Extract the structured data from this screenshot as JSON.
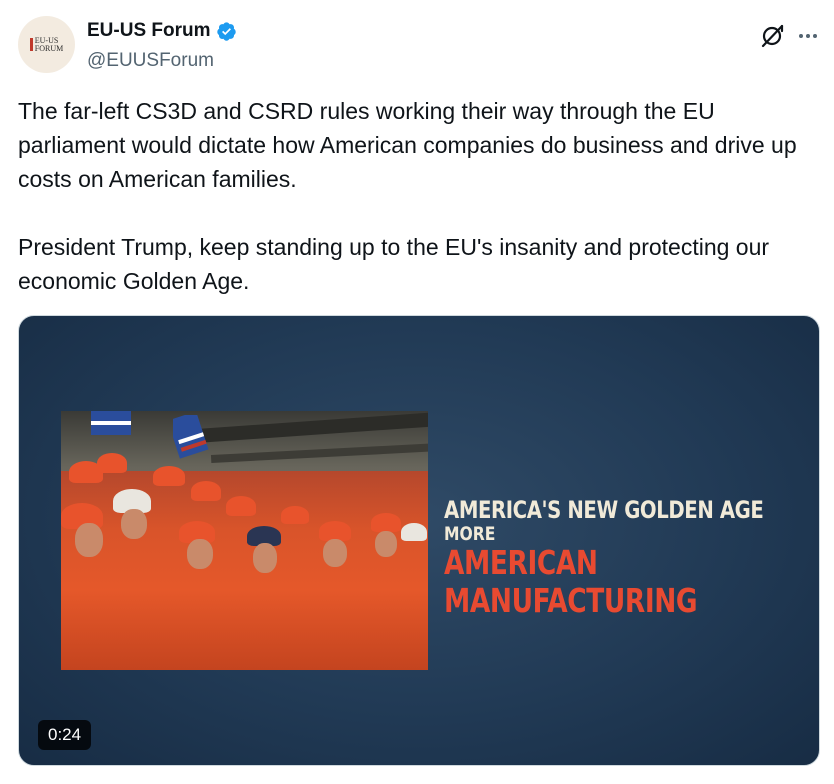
{
  "author": {
    "display_name": "EU-US Forum",
    "handle": "@EUUSForum",
    "verified": true,
    "avatar_text_line1": "EU-US",
    "avatar_text_line2": "FORUM"
  },
  "actions": {
    "grok_icon": "grok-icon",
    "more_icon": "more-options-icon"
  },
  "tweet": {
    "paragraphs": [
      "The far-left CS3D and CSRD rules working their way through the EU parliament would dictate how American companies do business and drive up costs on American families.",
      "President Trump, keep standing up to the EU's insanity and protecting our economic Golden Age."
    ]
  },
  "media": {
    "type": "video",
    "duration": "0:24",
    "overlay": {
      "line1": "AMERICA'S NEW GOLDEN AGE",
      "line2": "MORE",
      "line3": "AMERICAN",
      "line4": "MANUFACTURING"
    }
  },
  "colors": {
    "verified_badge": "#1d9bf0",
    "headline_red": "#e84a31",
    "text_primary": "#0f1419",
    "text_secondary": "#536471",
    "media_bg": "#213a55"
  }
}
